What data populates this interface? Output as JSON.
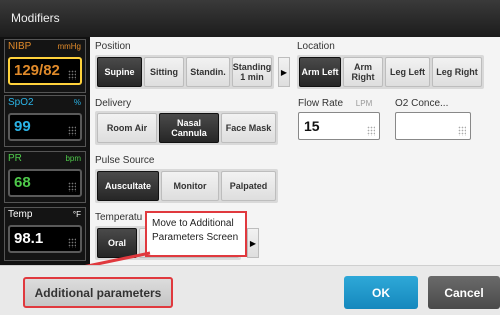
{
  "window": {
    "title": "Modifiers"
  },
  "vitals": [
    {
      "name": "NIBP",
      "unit": "mmHg",
      "value": "129/82",
      "color": "#e08a2a",
      "highlight": true
    },
    {
      "name": "SpO2",
      "unit": "%",
      "value": "99",
      "color": "#2ab3e6",
      "highlight": false
    },
    {
      "name": "PR",
      "unit": "bpm",
      "value": "68",
      "color": "#4ec94a",
      "highlight": false
    },
    {
      "name": "Temp",
      "unit": "°F",
      "value": "98.1",
      "color": "#ffffff",
      "highlight": false
    }
  ],
  "position": {
    "label": "Position",
    "options": [
      "Supine",
      "Sitting",
      "Standin.",
      "Standing\n1 min"
    ],
    "selected": "Supine"
  },
  "location": {
    "label": "Location",
    "options": [
      "Arm Left",
      "Arm\nRight",
      "Leg Left",
      "Leg Right"
    ],
    "selected": "Arm Left"
  },
  "delivery": {
    "label": "Delivery",
    "options": [
      "Room Air",
      "Nasal\nCannula",
      "Face Mask"
    ],
    "selected": "Nasal\nCannula"
  },
  "flow_rate": {
    "label": "Flow Rate",
    "unit": "LPM",
    "value": "15"
  },
  "o2_conc": {
    "label": "O2 Conce...",
    "value": ""
  },
  "pulse_source": {
    "label": "Pulse Source",
    "options": [
      "Auscultate",
      "Monitor",
      "Palpated"
    ],
    "selected": "Auscultate"
  },
  "temperature": {
    "label": "Temperatu",
    "options": [
      "Oral",
      "ctal"
    ],
    "selected": "Oral"
  },
  "callout": {
    "text": "Move to Additional Parameters Screen",
    "color": "#e0393e"
  },
  "footer": {
    "additional_label": "Additional parameters",
    "ok_label": "OK",
    "cancel_label": "Cancel"
  }
}
